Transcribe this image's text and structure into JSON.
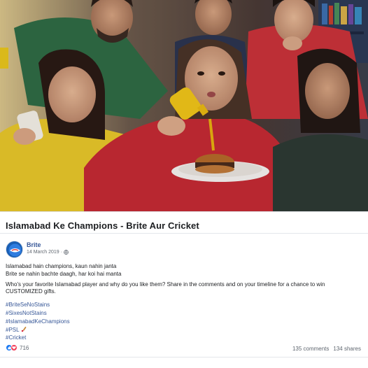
{
  "video": {
    "thumbnail_icon": "video-frame-people-watching-cricket"
  },
  "post": {
    "title": "Islamabad Ke Champions - Brite Aur Cricket",
    "page_name": "Brite",
    "date": "14 March 2019",
    "audience_icon": "globe-icon",
    "lines": [
      "Islamabad hain champions, kaun nahin janta",
      "Brite se nahin bachte daagh, har koi hai manta",
      "Who's your favorite Islamabad player and why do you like them? Share in the comments and on your timeline for a chance to win CUSTOMIZED gifts."
    ],
    "hashtags": [
      "#BriteSeNoStains",
      "#SixesNotStains",
      "#IslamabadKeChampions",
      "#PSL",
      "#Cricket"
    ],
    "reaction_count": "716",
    "comments": "135 comments",
    "shares": "134 shares",
    "colors": {
      "link": "#385898",
      "text": "#1c1e21",
      "muted": "#606770",
      "brand_blue": "#1a5fb4"
    }
  }
}
